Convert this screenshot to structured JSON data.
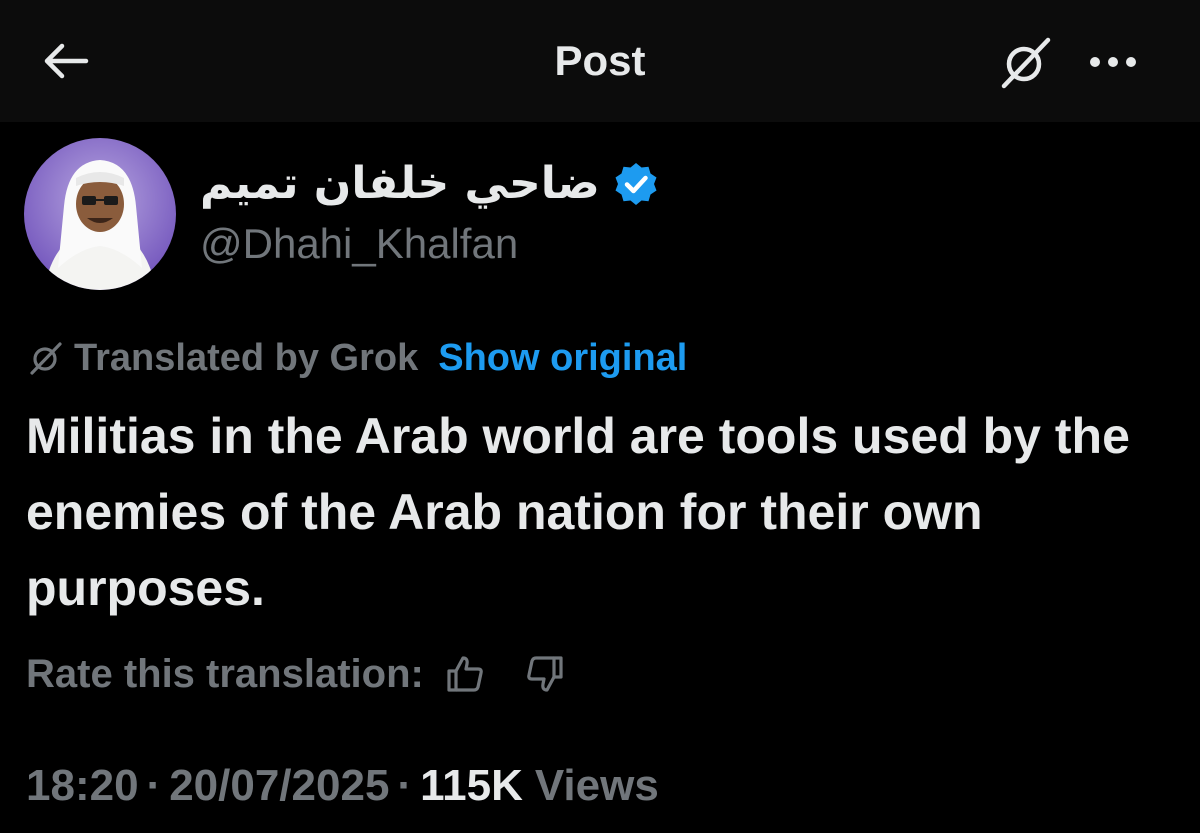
{
  "header": {
    "title": "Post",
    "back_icon": "arrow-left-icon",
    "grok_icon": "grok-icon",
    "more_icon": "more-horizontal-icon"
  },
  "author": {
    "display_name": "ضاحي خلفان تميم",
    "handle": "@Dhahi_Khalfan",
    "verified": true,
    "verified_color": "#1d9bf0"
  },
  "translation": {
    "label": "Translated by Grok",
    "show_original": "Show original",
    "rate_label": "Rate this translation:"
  },
  "post": {
    "text": "Militias in the Arab world are tools used by the enemies of the Arab nation for their own purposes."
  },
  "meta": {
    "time": "18:20",
    "date": "20/07/2025",
    "views_count": "115K",
    "views_label": "Views",
    "separator": "·"
  },
  "colors": {
    "background": "#000000",
    "header_background": "#0c0c0c",
    "text_primary": "#e7e9ea",
    "text_secondary": "#71767b",
    "accent": "#1d9bf0"
  }
}
